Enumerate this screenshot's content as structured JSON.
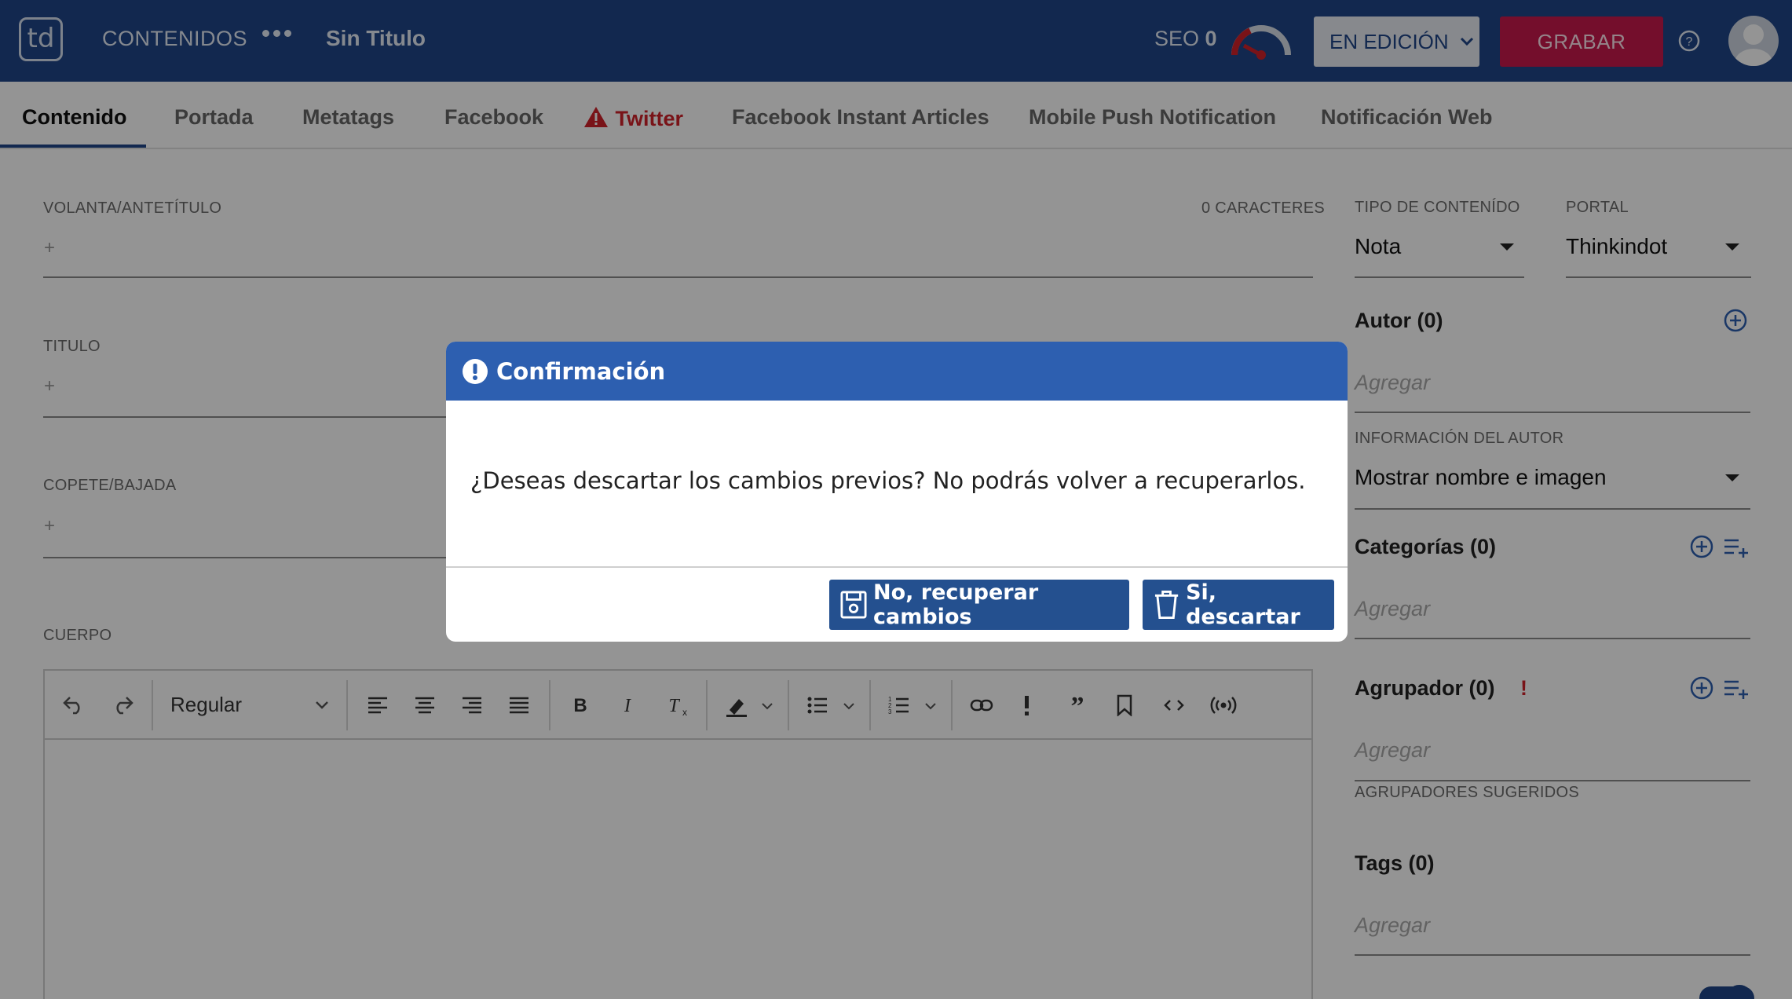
{
  "header": {
    "logo_text": "td",
    "nav_label": "CONTENIDOS",
    "doc_title": "Sin Titulo",
    "seo_label": "SEO",
    "seo_value": "0",
    "status_label": "EN EDICIÓN",
    "save_label": "GRABAR"
  },
  "tabs": [
    {
      "label": "Contenido",
      "active": true
    },
    {
      "label": "Portada"
    },
    {
      "label": "Metatags"
    },
    {
      "label": "Facebook"
    },
    {
      "label": "Twitter",
      "warning": true
    },
    {
      "label": "Facebook Instant Articles"
    },
    {
      "label": "Mobile Push Notification"
    },
    {
      "label": "Notificación Web"
    }
  ],
  "form": {
    "volanta_label": "VOLANTA/ANTETÍTULO",
    "volanta_chars": "0 CARACTERES",
    "titulo_label": "TITULO",
    "copete_label": "COPETE/BAJADA",
    "cuerpo_label": "CUERPO",
    "plus": "+"
  },
  "editor": {
    "format_value": "Regular"
  },
  "sidebar": {
    "tipo_label": "TIPO DE CONTENÍDO",
    "tipo_value": "Nota",
    "portal_label": "PORTAL",
    "portal_value": "Thinkindot",
    "autor_title": "Autor (0)",
    "autor_placeholder": "Agregar",
    "info_autor_label": "INFORMACIÓN DEL AUTOR",
    "info_autor_value": "Mostrar nombre e imagen",
    "categorias_title": "Categorías (0)",
    "categorias_placeholder": "Agregar",
    "agrupador_title": "Agrupador (0)",
    "agrupador_warn": "!",
    "agrupador_placeholder": "Agregar",
    "agrupadores_sugeridos": "AGRUPADORES SUGERIDOS",
    "tags_title": "Tags (0)",
    "tags_placeholder": "Agregar"
  },
  "modal": {
    "title": "Confirmación",
    "message": "¿Deseas descartar los cambios previos? No podrás volver a recuperarlos.",
    "recover_label": "No, recuperar cambios",
    "discard_label": "Si, descartar"
  },
  "colors": {
    "header_bg": "#1f4688",
    "save_bg": "#c8194c",
    "modal_header": "#2d5fb0",
    "modal_button": "#24508f",
    "warning": "#d0212a"
  }
}
